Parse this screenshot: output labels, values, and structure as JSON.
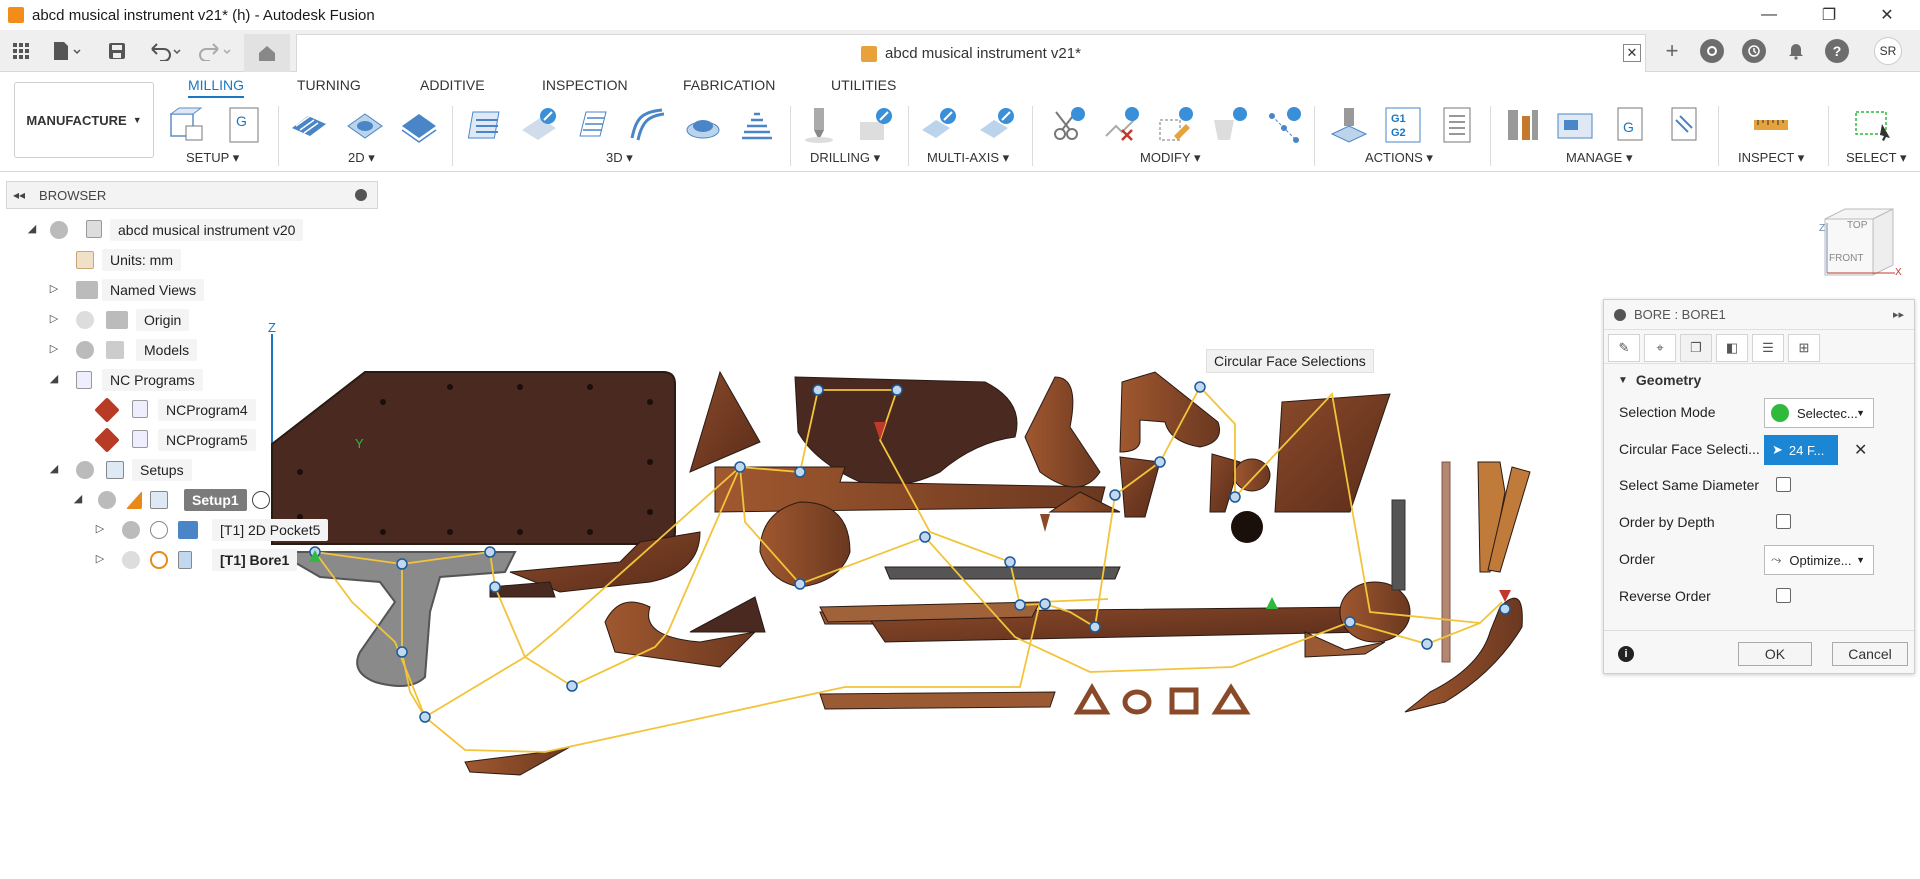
{
  "window": {
    "title": "abcd musical instrument v21* (h) - Autodesk Fusion",
    "minimize": "—",
    "restore": "❐",
    "close": "✕"
  },
  "toolbar": {
    "document_tab": "abcd musical instrument v21*",
    "tab_close": "✕",
    "user_initials": "SR",
    "help": "?"
  },
  "ribbon": {
    "workspace": "MANUFACTURE",
    "tabs": [
      "MILLING",
      "TURNING",
      "ADDITIVE",
      "INSPECTION",
      "FABRICATION",
      "UTILITIES"
    ],
    "active_tab": "MILLING",
    "groups": {
      "setup": "SETUP",
      "two_d": "2D",
      "three_d": "3D",
      "drilling": "DRILLING",
      "multi_axis": "MULTI-AXIS",
      "modify": "MODIFY",
      "actions": "ACTIONS",
      "manage": "MANAGE",
      "inspect": "INSPECT",
      "select": "SELECT"
    },
    "g1g2_icon_text": "G1\nG2"
  },
  "browser": {
    "title": "BROWSER",
    "items": [
      {
        "label": "abcd musical instrument v20"
      },
      {
        "label": "Units: mm"
      },
      {
        "label": "Named Views"
      },
      {
        "label": "Origin"
      },
      {
        "label": "Models"
      },
      {
        "label": "NC Programs"
      },
      {
        "label": "NCProgram4"
      },
      {
        "label": "NCProgram5"
      },
      {
        "label": "Setups"
      },
      {
        "label": "Setup1"
      },
      {
        "label": "[T1] 2D Pocket5"
      },
      {
        "label": "[T1] Bore1"
      }
    ]
  },
  "viewport": {
    "axis_z": "Z",
    "axis_y": "Y",
    "tooltip": "Circular Face Selections",
    "viewcube": {
      "top": "TOP",
      "front": "FRONT",
      "x": "X",
      "z": "Z"
    }
  },
  "dialog": {
    "title": "BORE : BORE1",
    "section": "Geometry",
    "rows": {
      "selection_mode_label": "Selection Mode",
      "selection_mode_value": "Selectec...",
      "circular_face_label": "Circular Face Selecti...",
      "circular_face_value": "24 F...",
      "same_diameter_label": "Select Same Diameter",
      "order_by_depth_label": "Order by Depth",
      "order_label": "Order",
      "order_value": "Optimize...",
      "reverse_order_label": "Reverse Order"
    },
    "ok": "OK",
    "cancel": "Cancel",
    "info": "i"
  },
  "colors": {
    "accent": "#1a78c2",
    "wood_dark": "#4a2a20",
    "wood_mid": "#7a3d22",
    "toolpath": "#f2c43a",
    "warning": "#c0392b",
    "selection_green": "#2fba3e"
  }
}
